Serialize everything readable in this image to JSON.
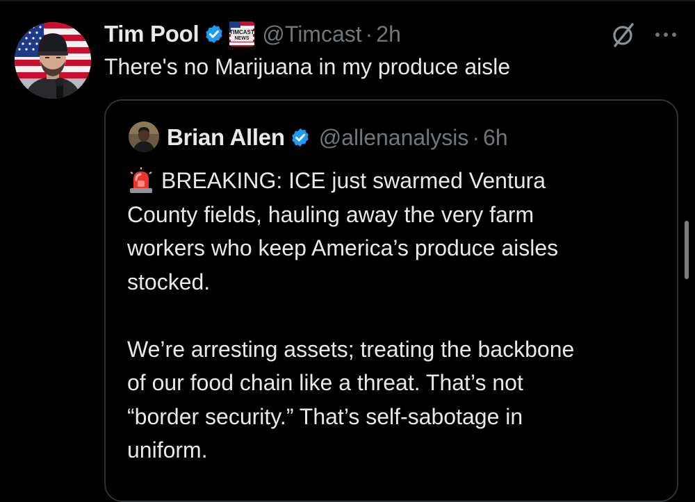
{
  "tweet": {
    "author": {
      "name": "Tim Pool",
      "handle": "@Timcast",
      "affiliation_badge_text": "TIMCAST NEWS"
    },
    "separator": "·",
    "time": "2h",
    "text": "There's no Marijuana in my produce aisle"
  },
  "quoted_tweet": {
    "author": {
      "name": "Brian Allen",
      "handle": "@allenanalysis"
    },
    "separator": "·",
    "time": "6h",
    "lines": [
      "BREAKING: ICE just swarmed Ventura",
      "County fields, hauling away the very farm",
      "workers who keep America’s produce aisles",
      "stocked.",
      "",
      "We’re arresting assets; treating the backbone",
      "of our food chain like a threat. That’s not",
      "“border security.” That’s self-sabotage in",
      "uniform."
    ]
  },
  "icons": {
    "verified": "verified-badge-icon",
    "grok": "grok-icon",
    "more": "more-options-icon",
    "siren": "siren-emoji-icon"
  },
  "colors": {
    "background": "#000000",
    "text_primary": "#e7e9ea",
    "text_secondary": "#71767b",
    "verified_blue": "#1d9bf0",
    "border": "#2f3336"
  }
}
